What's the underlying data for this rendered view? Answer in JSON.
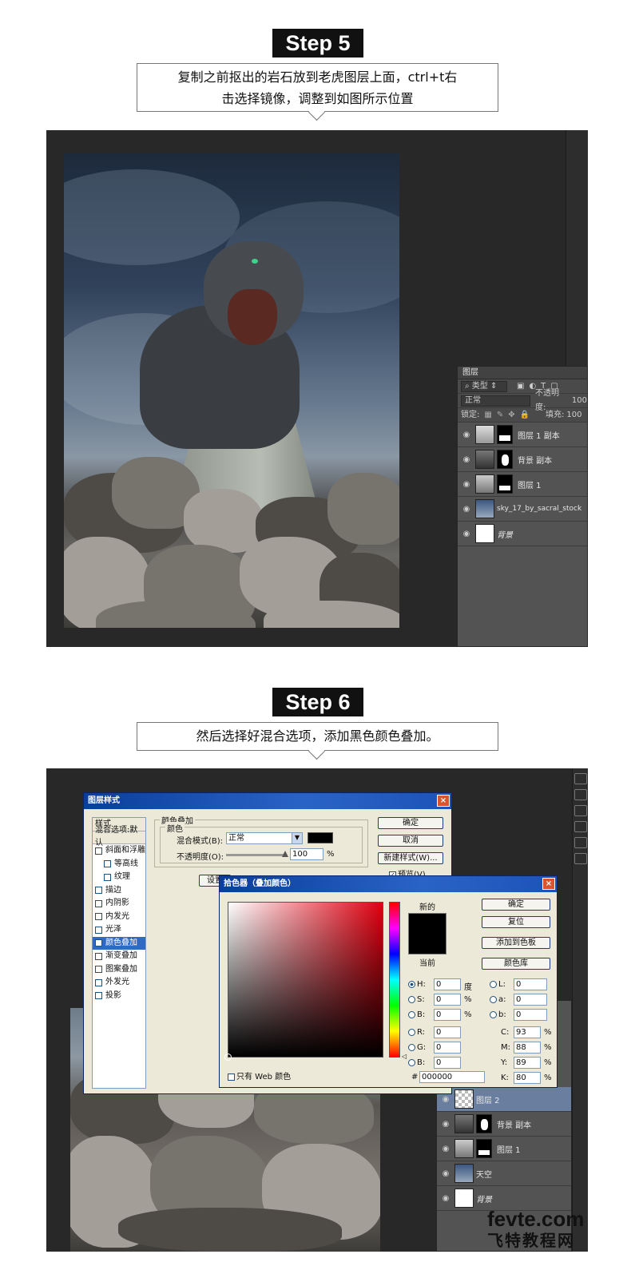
{
  "step5": {
    "badge": "Step 5",
    "caption_line1": "复制之前抠出的岩石放到老虎图层上面，ctrl+t右",
    "caption_line2": "击选择镜像，调整到如图所示位置",
    "layers_panel": {
      "title": "图层",
      "filter": "类型",
      "blend_mode": "正常",
      "opacity_label": "不透明度:",
      "opacity_value": "100",
      "lock_label": "锁定:",
      "fill_label": "填充:",
      "fill_value": "100",
      "layers": [
        {
          "name": "图层 1 副本"
        },
        {
          "name": "背景 副本"
        },
        {
          "name": "图层 1"
        },
        {
          "name": "sky_17_by_sacral_stock"
        },
        {
          "name": "背景"
        }
      ]
    }
  },
  "step6": {
    "badge": "Step 6",
    "caption": "然后选择好混合选项，添加黑色颜色叠加。",
    "layer_style_dialog": {
      "title": "图层样式",
      "close": "×",
      "styles_header": "样式",
      "blend_default": "混合选项:默认",
      "items": [
        {
          "label": "斜面和浮雕",
          "checked": false,
          "indent": false
        },
        {
          "label": "等高线",
          "checked": false,
          "indent": true
        },
        {
          "label": "纹理",
          "checked": false,
          "indent": true
        },
        {
          "label": "描边",
          "checked": false,
          "indent": false
        },
        {
          "label": "内阴影",
          "checked": false,
          "indent": false
        },
        {
          "label": "内发光",
          "checked": false,
          "indent": false
        },
        {
          "label": "光泽",
          "checked": false,
          "indent": false
        },
        {
          "label": "颜色叠加",
          "checked": true,
          "indent": false,
          "selected": true
        },
        {
          "label": "渐变叠加",
          "checked": false,
          "indent": false
        },
        {
          "label": "图案叠加",
          "checked": false,
          "indent": false
        },
        {
          "label": "外发光",
          "checked": false,
          "indent": false
        },
        {
          "label": "投影",
          "checked": false,
          "indent": false
        }
      ],
      "group_title": "颜色叠加",
      "sub_title": "颜色",
      "blend_mode_label": "混合模式(B):",
      "blend_mode_value": "正常",
      "opacity_label": "不透明度(O):",
      "opacity_value": "100",
      "percent": "%",
      "set_default": "设置",
      "ok": "确定",
      "cancel": "取消",
      "new_style": "新建样式(W)...",
      "preview_label": "预览(V)"
    },
    "color_picker": {
      "title": "拾色器（叠加颜色）",
      "close": "×",
      "new_label": "新的",
      "current_label": "当前",
      "ok": "确定",
      "reset": "复位",
      "add_swatch": "添加到色板",
      "color_library": "颜色库",
      "web_only": "只有 Web 颜色",
      "hash": "#",
      "hex": "000000",
      "fields": {
        "H": {
          "label": "H:",
          "value": "0",
          "unit": "度"
        },
        "S": {
          "label": "S:",
          "value": "0",
          "unit": "%"
        },
        "Bv": {
          "label": "B:",
          "value": "0",
          "unit": "%"
        },
        "R": {
          "label": "R:",
          "value": "0",
          "unit": ""
        },
        "G": {
          "label": "G:",
          "value": "0",
          "unit": ""
        },
        "B2": {
          "label": "B:",
          "value": "0",
          "unit": ""
        },
        "L": {
          "label": "L:",
          "value": "0",
          "unit": ""
        },
        "a": {
          "label": "a:",
          "value": "0",
          "unit": ""
        },
        "b": {
          "label": "b:",
          "value": "0",
          "unit": ""
        },
        "C": {
          "label": "C:",
          "value": "93",
          "unit": "%"
        },
        "M": {
          "label": "M:",
          "value": "88",
          "unit": "%"
        },
        "Y": {
          "label": "Y:",
          "value": "89",
          "unit": "%"
        },
        "K": {
          "label": "K:",
          "value": "80",
          "unit": "%"
        }
      },
      "swatch_color": "#000000"
    },
    "layers": [
      {
        "name": "图层 2"
      },
      {
        "name": "背景 副本"
      },
      {
        "name": "图层 1"
      },
      {
        "name": "天空"
      },
      {
        "name": "背景"
      }
    ]
  },
  "watermark": {
    "brand": "fevte.com",
    "sub": "飞特教程网"
  },
  "colors": {
    "badge_bg": "#111111",
    "workspace": "#282828",
    "dialog_title": "#0a3e9c",
    "selected_item": "#316ac5"
  }
}
